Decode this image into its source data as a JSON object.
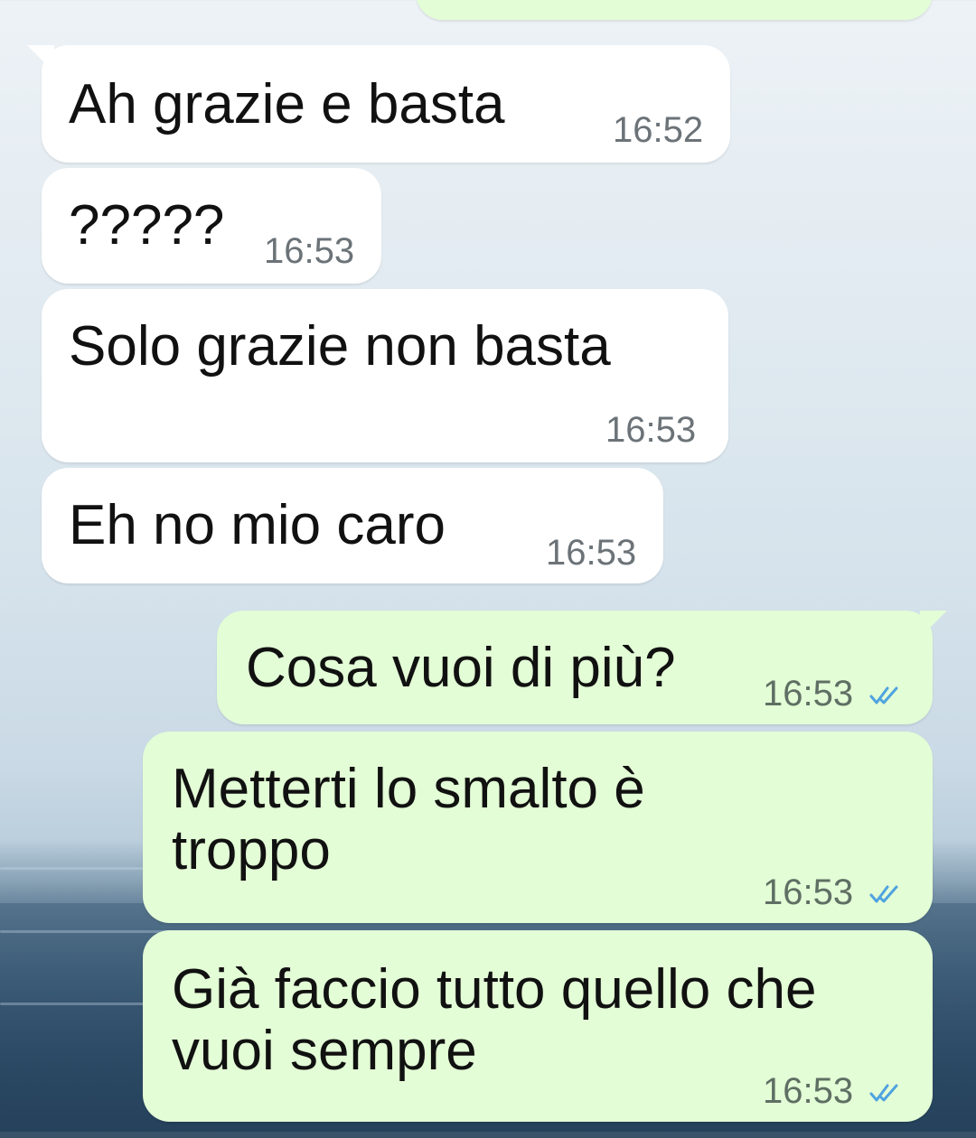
{
  "messages": [
    {
      "text": "Ah grazie e basta",
      "time": "16:52",
      "direction": "incoming"
    },
    {
      "text": "?????",
      "time": "16:53",
      "direction": "incoming"
    },
    {
      "text": "Solo grazie non basta",
      "time": "16:53",
      "direction": "incoming"
    },
    {
      "text": "Eh no mio caro",
      "time": "16:53",
      "direction": "incoming"
    },
    {
      "text": "Cosa vuoi di più?",
      "time": "16:53",
      "direction": "outgoing",
      "status": "read"
    },
    {
      "text": "Metterti lo smalto è troppo",
      "time": "16:53",
      "direction": "outgoing",
      "status": "read"
    },
    {
      "text": "Già faccio tutto quello che vuoi sempre",
      "time": "16:53",
      "direction": "outgoing",
      "status": "read"
    }
  ],
  "colors": {
    "incoming_bubble": "#ffffff",
    "outgoing_bubble": "#e3fdd6",
    "read_ticks": "#4fa3e0"
  },
  "icons": {
    "read_status": "double-check-icon"
  }
}
